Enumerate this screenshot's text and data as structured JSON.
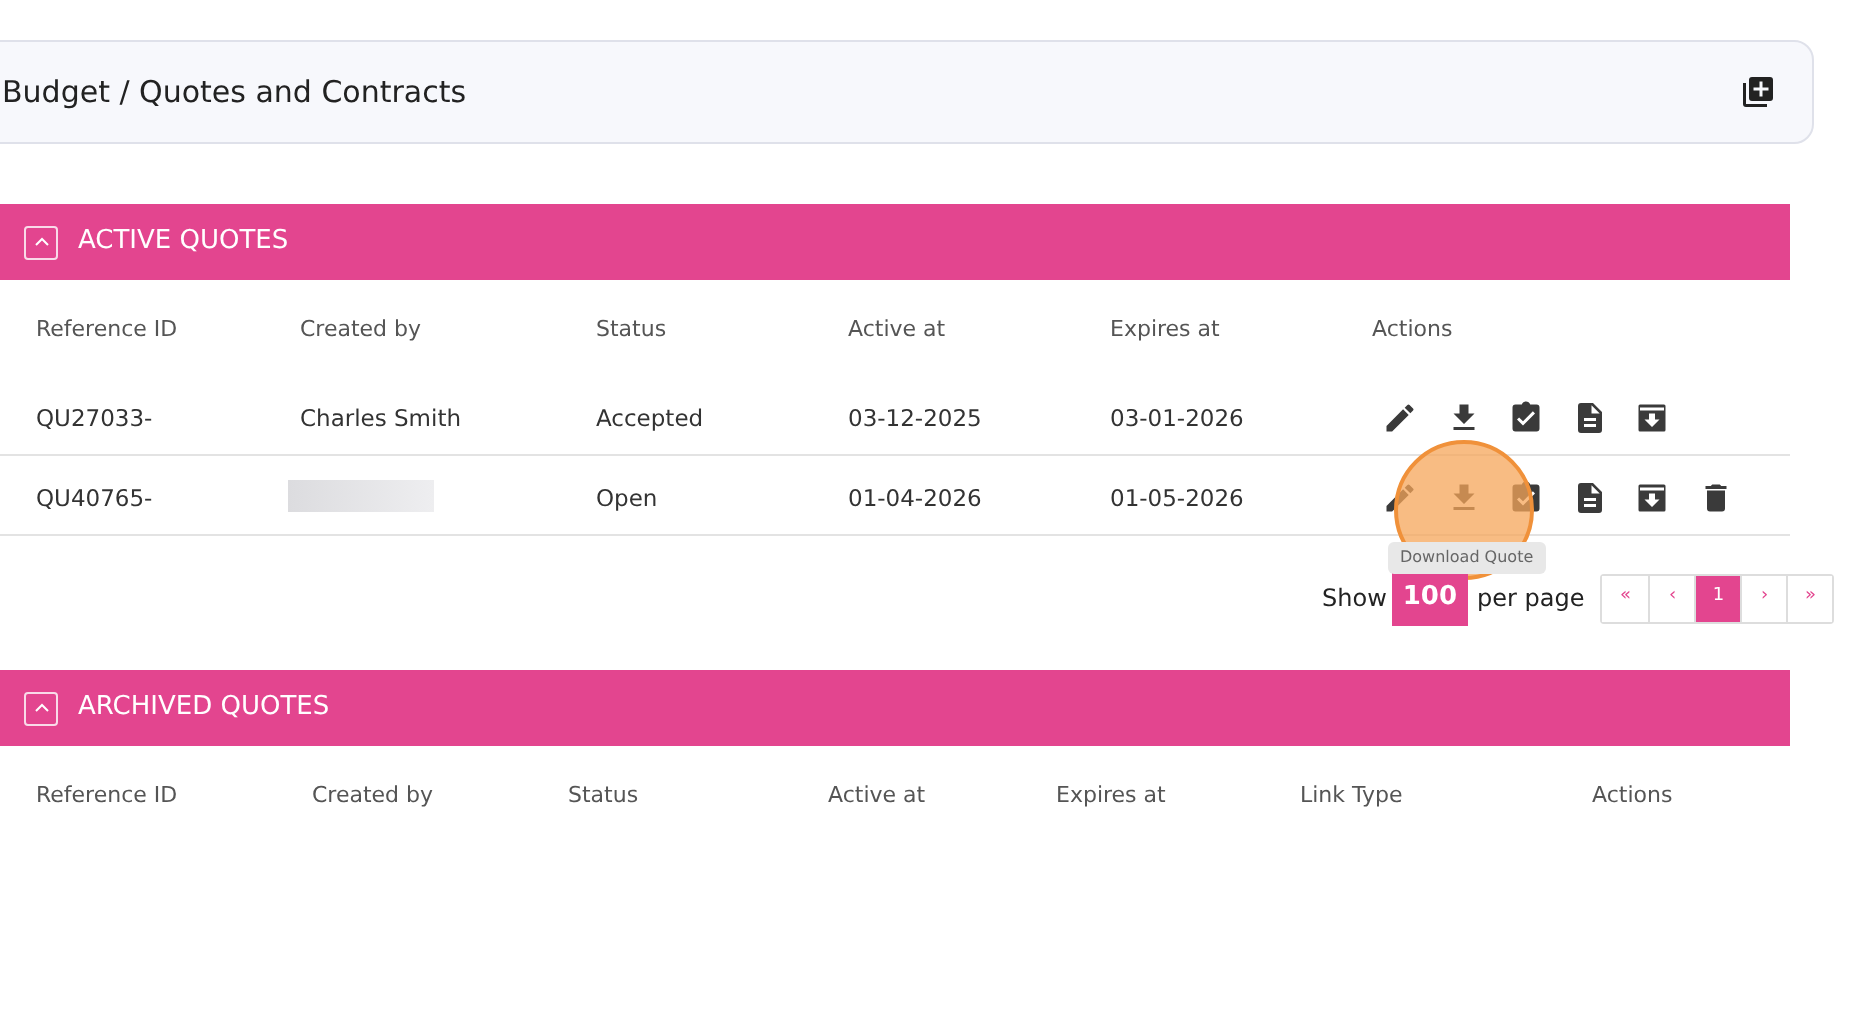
{
  "breadcrumb": {
    "title": "Budget / Quotes and Contracts"
  },
  "active_quotes": {
    "title": "ACTIVE QUOTES",
    "expanded": true,
    "columns": [
      "Reference ID",
      "Created by",
      "Status",
      "Active at",
      "Expires at",
      "Actions"
    ],
    "rows": [
      {
        "reference_id": "QU27033-",
        "created_by": "Charles Smith",
        "status": "Accepted",
        "active_at": "03-12-2025",
        "expires_at": "03-01-2026",
        "actions": [
          {
            "kind": "edit"
          },
          {
            "kind": "download"
          },
          {
            "kind": "approve"
          },
          {
            "kind": "document"
          },
          {
            "kind": "archive"
          }
        ]
      },
      {
        "reference_id": "QU40765-",
        "created_by_redacted": true,
        "status": "Open",
        "active_at": "01-04-2026",
        "expires_at": "01-05-2026",
        "actions": [
          {
            "kind": "edit"
          },
          {
            "kind": "download"
          },
          {
            "kind": "approve"
          },
          {
            "kind": "document"
          },
          {
            "kind": "archive"
          },
          {
            "kind": "delete"
          }
        ]
      }
    ],
    "tooltip": "Download Quote",
    "pagination": {
      "show_label": "Show",
      "page_size": "100",
      "per_page_label": "per page",
      "pages": [
        {
          "label": "«",
          "selected": false
        },
        {
          "label": "‹",
          "selected": false
        },
        {
          "label": "1",
          "selected": true
        },
        {
          "label": "›",
          "selected": false
        },
        {
          "label": "»",
          "selected": false
        }
      ]
    }
  },
  "archived_quotes": {
    "title": "ARCHIVED QUOTES",
    "expanded": true,
    "columns": [
      "Reference ID",
      "Created by",
      "Status",
      "Active at",
      "Expires at",
      "Link Type",
      "Actions"
    ]
  }
}
